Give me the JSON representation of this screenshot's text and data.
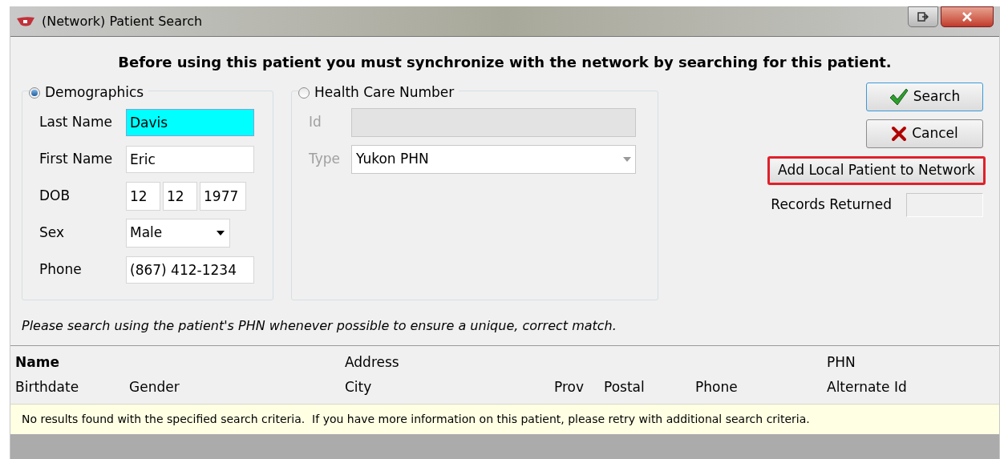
{
  "window": {
    "title": "(Network) Patient Search"
  },
  "notice": "Before using this patient you must synchronize with the network by searching for this patient.",
  "demographics": {
    "label": "Demographics",
    "selected": true,
    "fields": [
      {
        "kind": "text",
        "label": "Last Name",
        "value": "Davis",
        "focused": true
      },
      {
        "kind": "text",
        "label": "First Name",
        "value": "Eric",
        "focused": false
      },
      {
        "kind": "date",
        "label": "DOB",
        "parts": [
          "12",
          "12",
          "1977"
        ]
      },
      {
        "kind": "select",
        "label": "Sex",
        "value": "Male"
      },
      {
        "kind": "text",
        "label": "Phone",
        "value": "(867) 412-1234",
        "focused": false
      }
    ]
  },
  "health_care": {
    "label": "Health Care Number",
    "selected": false,
    "disabled": true,
    "fields": [
      {
        "kind": "text",
        "label": "Id"
      },
      {
        "kind": "select",
        "label": "Type",
        "value": "Yukon PHN"
      }
    ]
  },
  "buttons": [
    {
      "kind": "search",
      "label": "Search",
      "highlighted": false
    },
    {
      "kind": "cancel",
      "label": "Cancel",
      "highlighted": false
    },
    {
      "kind": "plain",
      "label": "Add Local Patient to Network",
      "highlighted": true
    }
  ],
  "records_returned": {
    "label": "Records Returned"
  },
  "hint": "Please search using the patient's PHN whenever possible to ensure a unique, correct match.",
  "table": {
    "columns_row_1": [
      {
        "label": "Name",
        "bold": true
      },
      {
        "label": "Address",
        "bold": false
      },
      {
        "label": "PHN",
        "bold": false
      }
    ],
    "columns_row_2": [
      "Birthdate",
      "Gender",
      "City",
      "Prov",
      "Postal",
      "Phone",
      "Alternate Id"
    ],
    "message": "No results found with the specified search criteria.  If you have more information on this patient, please retry with additional search criteria."
  }
}
